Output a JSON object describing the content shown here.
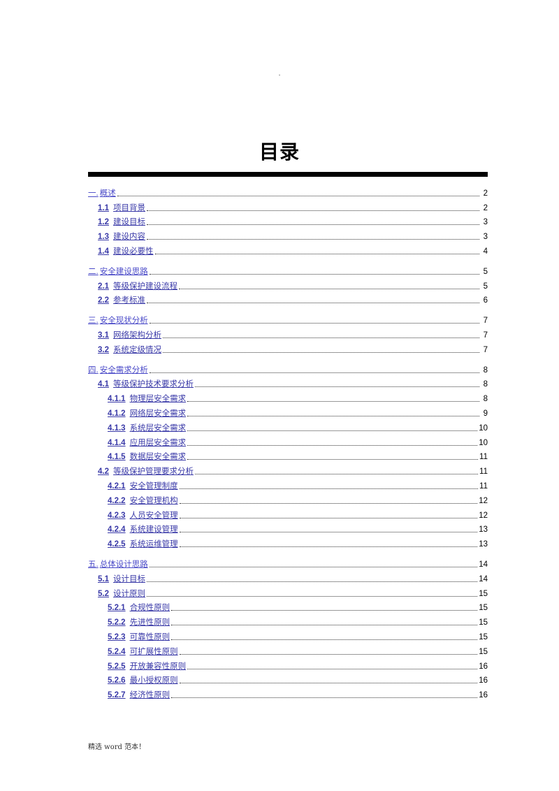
{
  "header": {
    "mark": "."
  },
  "title": "目录",
  "toc": [
    {
      "level": 1,
      "num": "一.",
      "label": "概述",
      "page": "2"
    },
    {
      "level": 2,
      "num": "1.1",
      "label": "项目背景",
      "page": "2"
    },
    {
      "level": 2,
      "num": "1.2",
      "label": "建设目标",
      "page": "3"
    },
    {
      "level": 2,
      "num": "1.3",
      "label": "建设内容",
      "page": "3"
    },
    {
      "level": 2,
      "num": "1.4",
      "label": "建设必要性",
      "page": "4"
    },
    {
      "level": 1,
      "num": "二.",
      "label": "安全建设思路",
      "page": "5"
    },
    {
      "level": 2,
      "num": "2.1",
      "label": "等级保护建设流程",
      "page": "5"
    },
    {
      "level": 2,
      "num": "2.2",
      "label": "参考标准",
      "page": "6"
    },
    {
      "level": 1,
      "num": "三.",
      "label": "安全现状分析",
      "page": "7"
    },
    {
      "level": 2,
      "num": "3.1",
      "label": "网络架构分析",
      "page": "7"
    },
    {
      "level": 2,
      "num": "3.2",
      "label": "系统定级情况",
      "page": "7"
    },
    {
      "level": 1,
      "num": "四.",
      "label": "安全需求分析",
      "page": "8"
    },
    {
      "level": 2,
      "num": "4.1",
      "label": "等级保护技术要求分析",
      "page": "8"
    },
    {
      "level": 3,
      "num": "4.1.1",
      "label": "物理层安全需求",
      "page": "8"
    },
    {
      "level": 3,
      "num": "4.1.2",
      "label": "网络层安全需求",
      "page": "9"
    },
    {
      "level": 3,
      "num": "4.1.3",
      "label": "系统层安全需求",
      "page": "10"
    },
    {
      "level": 3,
      "num": "4.1.4",
      "label": "应用层安全需求",
      "page": "10"
    },
    {
      "level": 3,
      "num": "4.1.5",
      "label": "数据层安全需求",
      "page": "11"
    },
    {
      "level": 2,
      "num": "4.2",
      "label": "等级保护管理要求分析",
      "page": "11"
    },
    {
      "level": 3,
      "num": "4.2.1",
      "label": "安全管理制度",
      "page": "11"
    },
    {
      "level": 3,
      "num": "4.2.2",
      "label": "安全管理机构",
      "page": "12"
    },
    {
      "level": 3,
      "num": "4.2.3",
      "label": "人员安全管理",
      "page": "12"
    },
    {
      "level": 3,
      "num": "4.2.4",
      "label": "系统建设管理",
      "page": "13"
    },
    {
      "level": 3,
      "num": "4.2.5",
      "label": "系统运维管理",
      "page": "13"
    },
    {
      "level": 1,
      "num": "五.",
      "label": "总体设计思路",
      "page": "14"
    },
    {
      "level": 2,
      "num": "5.1",
      "label": "设计目标",
      "page": "14"
    },
    {
      "level": 2,
      "num": "5.2",
      "label": "设计原则",
      "page": "15"
    },
    {
      "level": 3,
      "num": "5.2.1",
      "label": "合规性原则",
      "page": "15"
    },
    {
      "level": 3,
      "num": "5.2.2",
      "label": "先进性原则",
      "page": "15"
    },
    {
      "level": 3,
      "num": "5.2.3",
      "label": "可靠性原则",
      "page": "15"
    },
    {
      "level": 3,
      "num": "5.2.4",
      "label": "可扩展性原则",
      "page": "15"
    },
    {
      "level": 3,
      "num": "5.2.5",
      "label": "开放兼容性原则",
      "page": "16"
    },
    {
      "level": 3,
      "num": "5.2.6",
      "label": "最小授权原则",
      "page": "16"
    },
    {
      "level": 3,
      "num": "5.2.7",
      "label": "经济性原则",
      "page": "16"
    }
  ],
  "footer": "精选 word 范本！",
  "colors": {
    "link": "#3a3aa8",
    "rule": "#000000"
  }
}
